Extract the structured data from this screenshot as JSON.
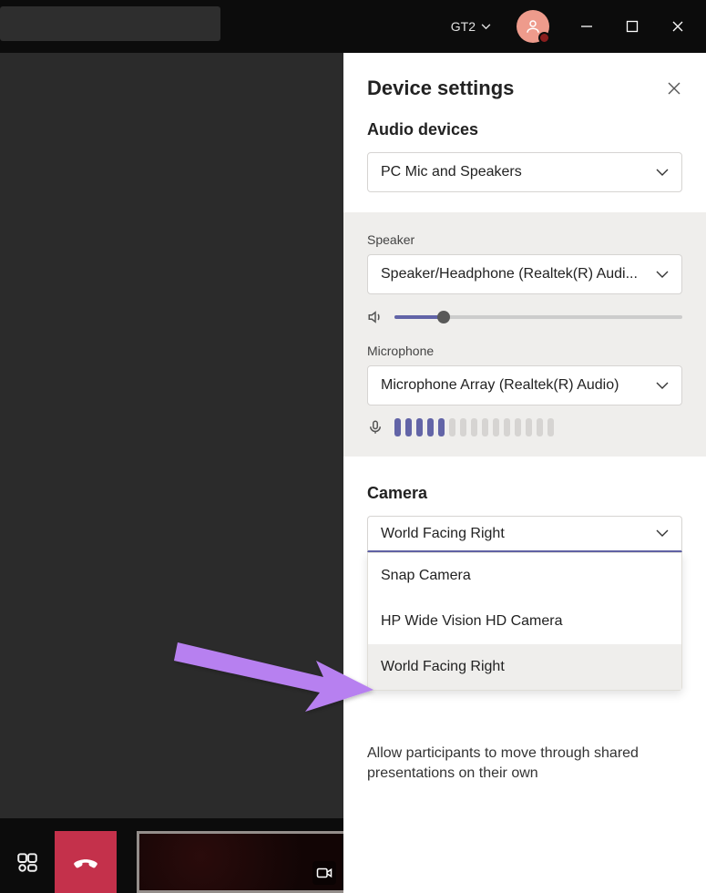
{
  "titlebar": {
    "org_label": "GT2"
  },
  "panel": {
    "title": "Device settings",
    "audio": {
      "heading": "Audio devices",
      "device_selected": "PC Mic and Speakers"
    },
    "speaker": {
      "label": "Speaker",
      "selected": "Speaker/Headphone (Realtek(R) Audi...",
      "volume_pct": 17
    },
    "microphone": {
      "label": "Microphone",
      "selected": "Microphone Array (Realtek(R) Audio)",
      "level_bars_on": 5,
      "level_bars_total": 15
    },
    "camera": {
      "label": "Camera",
      "selected": "World Facing Right",
      "options": [
        "Snap Camera",
        "HP Wide Vision HD Camera",
        "World Facing Right"
      ]
    },
    "helper": "Allow participants to move through shared presentations on their own"
  }
}
